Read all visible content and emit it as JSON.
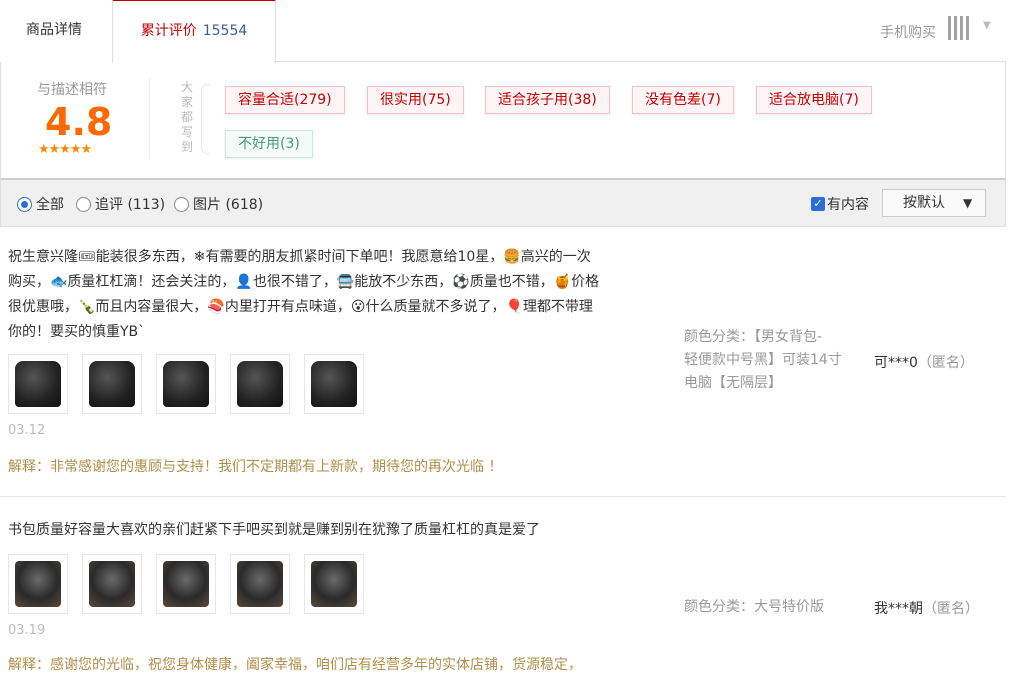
{
  "tabs": {
    "detail": "商品详情",
    "reviews": "累计评价",
    "reviews_count": "15554",
    "mobile_buy": "手机购买"
  },
  "rating": {
    "title": "与描述相符",
    "score": "4.8",
    "stars": "★★★★★"
  },
  "everyone_wrote": "大家都写到",
  "tags": [
    {
      "label": "容量合适(279)",
      "type": "pos"
    },
    {
      "label": "很实用(75)",
      "type": "pos"
    },
    {
      "label": "适合孩子用(38)",
      "type": "pos"
    },
    {
      "label": "没有色差(7)",
      "type": "pos"
    },
    {
      "label": "适合放电脑(7)",
      "type": "pos"
    },
    {
      "label": "不好用(3)",
      "type": "neg"
    }
  ],
  "filters": {
    "all": "全部",
    "followup": "追评 (113)",
    "pictures": "图片 (618)",
    "has_content": "有内容",
    "sort": "按默认"
  },
  "reviews": [
    {
      "text_lines": [
        "祝生意兴隆🎟能装很多东西，❄有需要的朋友抓紧时间下单吧！我愿意给10星，🍔高兴的一次",
        "购买，🐟质量杠杠滴！还会关注的，👤也很不错了，🚍能放不少东西，⚽质量也不错，🍯价格",
        "很优惠哦，🍾而且内容量很大，🍣内里打开有点味道，😮什么质量就不多说了，🎈理都不带理",
        "你的！要买的慎重YB`"
      ],
      "date": "03.12",
      "reply": "解释：非常感谢您的惠顾与支持！我们不定期都有上新款，期待您的再次光临 ！",
      "meta_lines": [
        "颜色分类：【男女背包-",
        "轻便款中号黑】可装14寸",
        "电脑【无隔层】"
      ],
      "author": "可***0",
      "anon": "（匿名）"
    },
    {
      "text_lines": [
        "书包质量好容量大喜欢的亲们赶紧下手吧买到就是赚到别在犹豫了质量杠杠的真是爱了"
      ],
      "date": "03.19",
      "reply": "解释：感谢您的光临，祝您身体健康，阖家幸福，咱们店有经营多年的实体店铺，货源稳定，",
      "meta_lines": [
        "颜色分类：大号特价版"
      ],
      "author": "我***朝",
      "anon": "（匿名）"
    }
  ]
}
